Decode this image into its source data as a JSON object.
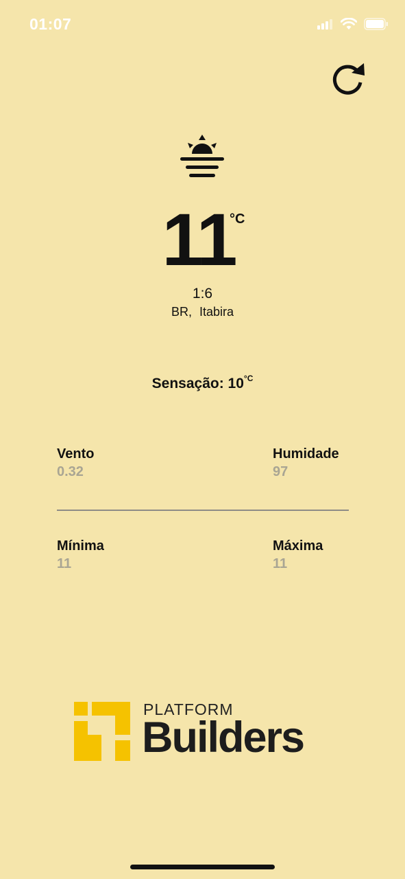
{
  "status_bar": {
    "time": "01:07"
  },
  "weather": {
    "temperature": "11",
    "unit": "°C",
    "time": "1:6",
    "location": "BR,  Itabira",
    "feels_like_label": "Sensação: 10",
    "feels_like_unit": "°C"
  },
  "stats": {
    "wind_label": "Vento",
    "wind_value": "0.32",
    "humidity_label": "Humidade",
    "humidity_value": "97",
    "min_label": "Mínima",
    "min_value": "11",
    "max_label": "Máxima",
    "max_value": "11"
  },
  "logo": {
    "top_text": "PLATFORM",
    "main_text": "Builders",
    "accent_color": "#f5c200"
  },
  "icons": {
    "refresh": "refresh-icon",
    "weather": "sunrise-fog-icon"
  }
}
